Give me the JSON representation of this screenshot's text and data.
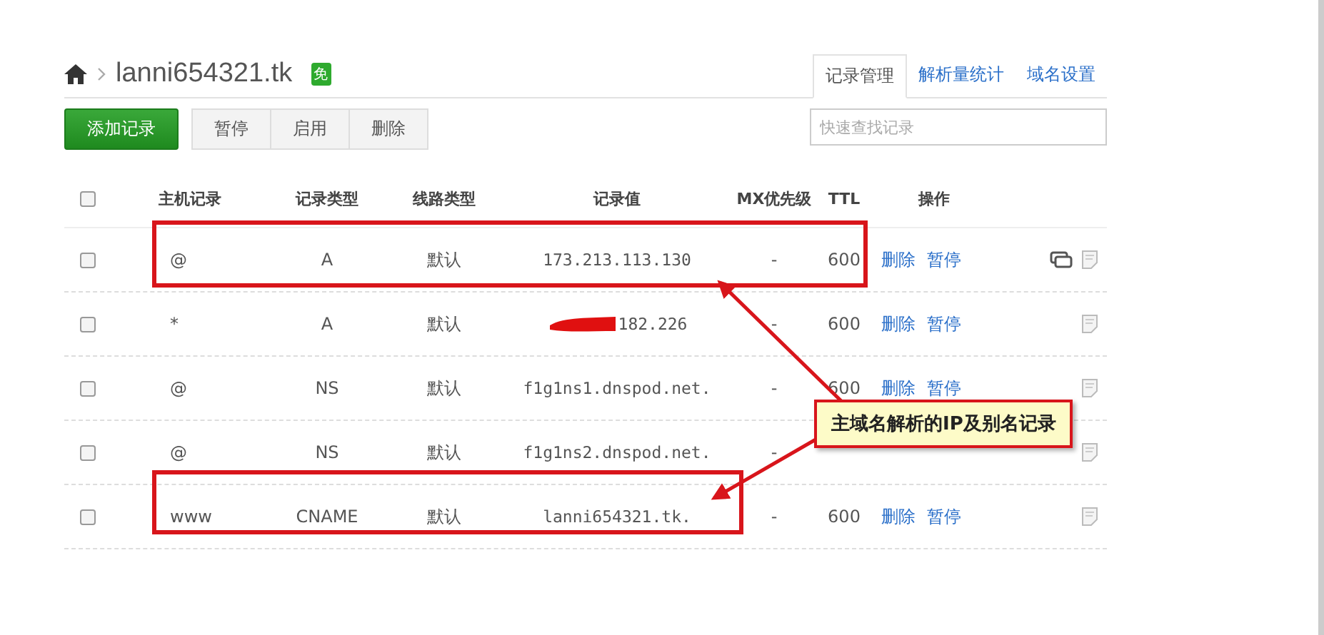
{
  "breadcrumb": {
    "domain": "lanni654321.tk",
    "badge": "免"
  },
  "tabs": [
    {
      "label": "记录管理",
      "selected": true
    },
    {
      "label": "解析量统计",
      "selected": false
    },
    {
      "label": "域名设置",
      "selected": false
    }
  ],
  "buttons": [
    {
      "label": "添加记录",
      "kind": "primary"
    },
    {
      "label": "暂停",
      "kind": "plain"
    },
    {
      "label": "启用",
      "kind": "plain"
    },
    {
      "label": "删除",
      "kind": "plain"
    }
  ],
  "search": {
    "placeholder": "快速查找记录"
  },
  "table": {
    "header_checkbox": {
      "checked": false
    },
    "columns": [
      "主机记录",
      "记录类型",
      "线路类型",
      "记录值",
      "MX优先级",
      "TTL",
      "操作"
    ],
    "rows": [
      {
        "checked": false,
        "host": "@",
        "type": "A",
        "line": "默认",
        "value": "173.213.113.130",
        "redacted": false,
        "mx": "-",
        "ttl": "600",
        "actions": [
          "删除",
          "暂停"
        ],
        "icons": [
          {
            "kind": "comments"
          },
          {
            "kind": "note"
          }
        ]
      },
      {
        "checked": false,
        "host": "*",
        "type": "A",
        "line": "默认",
        "value": "182.226",
        "redacted": true,
        "mx": "-",
        "ttl": "600",
        "actions": [
          "删除",
          "暂停"
        ],
        "icons": [
          {
            "kind": "note"
          }
        ]
      },
      {
        "checked": false,
        "host": "@",
        "type": "NS",
        "line": "默认",
        "value": "f1g1ns1.dnspod.net.",
        "redacted": false,
        "mx": "-",
        "ttl": "600",
        "actions": [
          "删除",
          "暂停"
        ],
        "icons": [
          {
            "kind": "note"
          }
        ]
      },
      {
        "checked": false,
        "host": "@",
        "type": "NS",
        "line": "默认",
        "value": "f1g1ns2.dnspod.net.",
        "redacted": false,
        "mx": "-",
        "actions": [],
        "icons": [
          {
            "kind": "note"
          }
        ]
      },
      {
        "checked": false,
        "host": "www",
        "type": "CNAME",
        "line": "默认",
        "value": "lanni654321.tk.",
        "redacted": false,
        "mx": "-",
        "ttl": "600",
        "actions": [
          "删除",
          "暂停"
        ],
        "icons": [
          {
            "kind": "note"
          }
        ]
      }
    ]
  },
  "annotation": {
    "callout": "主域名解析的IP及别名记录"
  }
}
